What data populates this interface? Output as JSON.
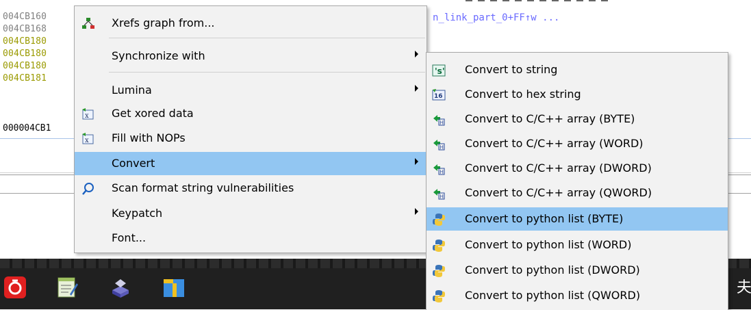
{
  "background": {
    "addresses": [
      {
        "text": "004CB160",
        "color": "#808080"
      },
      {
        "text": "004CB168",
        "color": "#808080"
      },
      {
        "text": "004CB180",
        "color": "#9a9a00"
      },
      {
        "text": "004CB180",
        "color": "#9a9a00"
      },
      {
        "text": "004CB180",
        "color": "#9a9a00"
      },
      {
        "text": "004CB181",
        "color": "#9a9a00"
      }
    ],
    "code_fragment": "n_link_part_0+FF↑w ...",
    "hex_status": "000004CB1"
  },
  "context_menu": {
    "items": [
      {
        "label": "Xrefs graph from...",
        "icon": "xrefs-graph-icon",
        "submenu": false
      },
      {
        "label": "Synchronize with",
        "icon": "",
        "submenu": true
      },
      {
        "label": "Lumina",
        "icon": "",
        "submenu": true
      },
      {
        "label": "Get xored data",
        "icon": "script-x-icon",
        "submenu": false
      },
      {
        "label": "Fill with NOPs",
        "icon": "script-x-icon",
        "submenu": false
      },
      {
        "label": "Convert",
        "icon": "",
        "submenu": true,
        "highlighted": true
      },
      {
        "label": "Scan format string vulnerabilities",
        "icon": "magnifier-icon",
        "submenu": false
      },
      {
        "label": "Keypatch",
        "icon": "",
        "submenu": true
      },
      {
        "label": "Font...",
        "icon": "",
        "submenu": false
      }
    ]
  },
  "submenu": {
    "items": [
      {
        "label": "Convert to string",
        "icon": "string-s-icon"
      },
      {
        "label": "Convert to hex string",
        "icon": "hex-16-icon"
      },
      {
        "label": "Convert to C/C++ array (BYTE)",
        "icon": "array-icon"
      },
      {
        "label": "Convert to C/C++ array (WORD)",
        "icon": "array-icon"
      },
      {
        "label": "Convert to C/C++ array (DWORD)",
        "icon": "array-icon"
      },
      {
        "label": "Convert to C/C++ array (QWORD)",
        "icon": "array-icon"
      },
      {
        "label": "Convert to python list (BYTE)",
        "icon": "python-icon",
        "highlighted": true
      },
      {
        "label": "Convert to python list (WORD)",
        "icon": "python-icon"
      },
      {
        "label": "Convert to python list (DWORD)",
        "icon": "python-icon"
      },
      {
        "label": "Convert to python list (QWORD)",
        "icon": "python-icon"
      }
    ]
  },
  "taskbar": {
    "apps": [
      "netease-music-icon",
      "notepad-icon",
      "installer-icon",
      "archive-icon"
    ],
    "right_char": "夫"
  },
  "colors": {
    "highlight": "#92c6f2",
    "menu_bg": "#f2f2f2",
    "taskbar": "#202020"
  }
}
